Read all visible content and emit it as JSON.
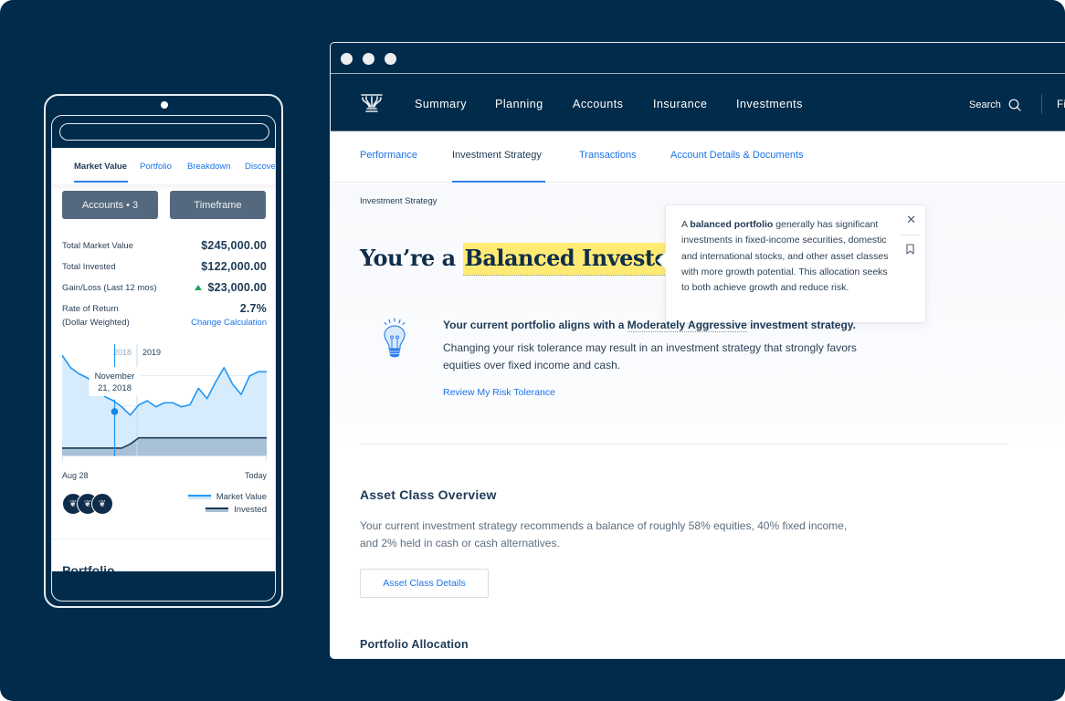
{
  "colors": {
    "background": "#002b4a",
    "accent": "#1a73e8",
    "highlight": "#ffeb73",
    "text_dark": "#1d3a55",
    "gain": "#20a35a",
    "market_value_line": "#2196f3",
    "market_value_fill": "#d6ebfb",
    "invested_fill": "#a9c1d6"
  },
  "mobile": {
    "tabs": [
      {
        "label": "Market Value",
        "active": true
      },
      {
        "label": "Portfolio"
      },
      {
        "label": "Breakdown"
      },
      {
        "label": "Discover"
      }
    ],
    "accounts_button": "Accounts • 3",
    "timeframe_button": "Timeframe",
    "stats": [
      {
        "label": "Total Market Value",
        "value": "$245,000.00"
      },
      {
        "label": "Total Invested",
        "value": "$122,000.00"
      },
      {
        "label": "Gain/Loss (Last 12 mos)",
        "value": "$23,000.00",
        "trend": "up"
      },
      {
        "label": "Rate of Return",
        "value": "2.7%"
      },
      {
        "label": "(Dollar Weighted)",
        "link": "Change Calculation"
      }
    ],
    "chart": {
      "year_labels": [
        "2018",
        "2019"
      ],
      "tooltip_line1": "November",
      "tooltip_line2": "21, 2018",
      "x_start": "Aug 28",
      "x_end": "Today",
      "market_value": [
        98,
        86,
        80,
        76,
        68,
        58,
        54,
        48,
        40,
        50,
        54,
        48,
        52,
        52,
        48,
        50,
        66,
        56,
        72,
        86,
        70,
        60,
        78,
        82,
        82
      ],
      "invested": [
        8,
        8,
        8,
        8,
        8,
        8,
        8,
        8,
        12,
        18,
        18,
        18,
        18,
        18,
        18,
        18,
        18,
        18,
        18,
        18,
        18,
        18,
        18,
        18,
        18
      ],
      "selected_index": 6,
      "year_divider_index": 9
    },
    "legend": [
      {
        "label": "Market Value"
      },
      {
        "label": "Invested"
      }
    ],
    "account_icons": [
      "column-logo",
      "column-logo",
      "column-logo"
    ],
    "section_title": "Portfolio"
  },
  "browser": {
    "nav": {
      "items": [
        "Summary",
        "Planning",
        "Accounts",
        "Insurance",
        "Investments"
      ],
      "search_label": "Search",
      "truncated_item": "Fi"
    },
    "subnav": {
      "tabs": [
        {
          "label": "Performance"
        },
        {
          "label": "Investment Strategy",
          "active": true
        },
        {
          "label": "Transactions"
        },
        {
          "label": "Account Details & Documents"
        }
      ]
    },
    "breadcrumb": "Investment Strategy",
    "title_prefix": "You’re a ",
    "title_highlight": "Balanced Investor.",
    "popover": {
      "bold_term": "balanced portfolio",
      "prefix": "A ",
      "text": " generally has significant investments in fixed-income securities, domestic and international stocks, and other asset classes with more growth potential. This allocation seeks to both achieve growth and reduce risk."
    },
    "alignment": {
      "prefix": "Your current portfolio aligns with a ",
      "term": "Moderately Aggressive",
      "suffix": " investment strategy.",
      "description": "Changing your risk tolerance may result in an investment strategy that strongly favors equities over fixed income and cash.",
      "link": "Review My Risk Tolerance"
    },
    "asset_class": {
      "heading": "Asset Class Overview",
      "paragraph": "Your current investment strategy recommends a balance of roughly 58% equities, 40% fixed income, and 2% held in cash or cash alternatives.",
      "button": "Asset Class Details"
    },
    "portfolio_allocation_heading": "Portfolio Allocation"
  }
}
